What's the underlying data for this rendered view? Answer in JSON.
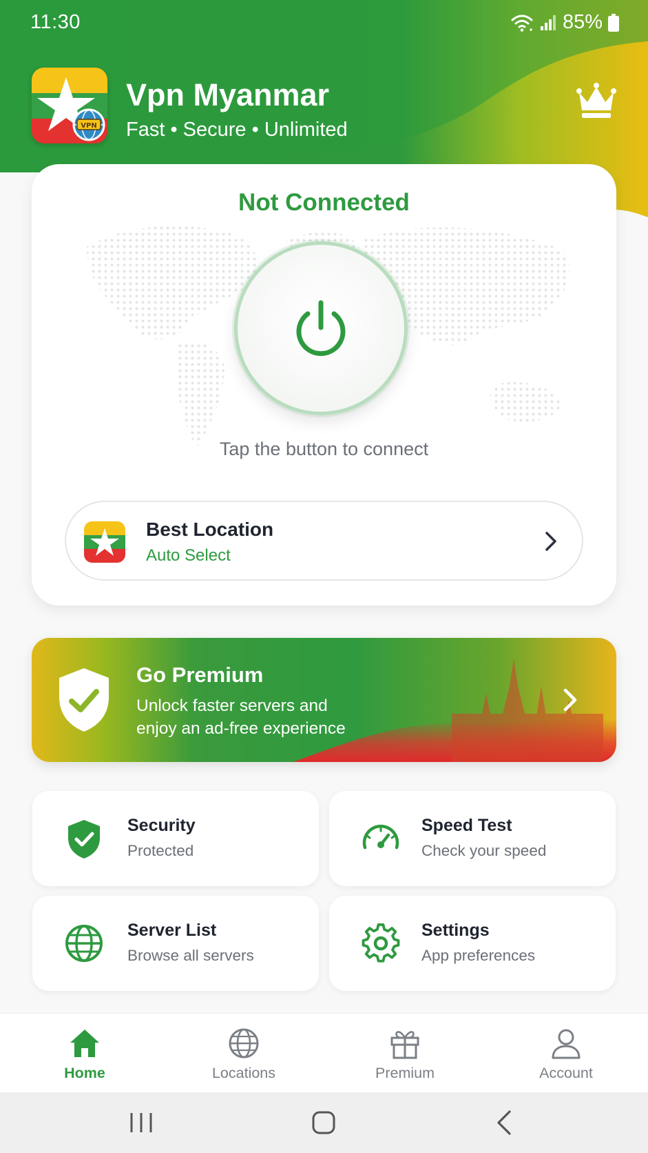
{
  "status_bar": {
    "time": "11:30",
    "battery": "85%"
  },
  "header": {
    "title": "Vpn Myanmar",
    "subtitle": "Fast • Secure • Unlimited",
    "logo_badge": "VPN"
  },
  "connection": {
    "status": "Not Connected",
    "hint": "Tap the button to connect"
  },
  "location": {
    "title": "Best Location",
    "subtitle": "Auto Select"
  },
  "premium": {
    "title": "Go Premium",
    "line1": "Unlock faster servers and",
    "line2": "enjoy an ad-free experience"
  },
  "features": [
    {
      "title": "Security",
      "subtitle": "Protected",
      "icon": "shield-check-icon"
    },
    {
      "title": "Speed Test",
      "subtitle": "Check your speed",
      "icon": "speedometer-icon"
    },
    {
      "title": "Server List",
      "subtitle": "Browse all servers",
      "icon": "globe-icon"
    },
    {
      "title": "Settings",
      "subtitle": "App preferences",
      "icon": "gear-icon"
    }
  ],
  "nav": [
    {
      "label": "Home",
      "icon": "home-icon",
      "active": true
    },
    {
      "label": "Locations",
      "icon": "globe-icon",
      "active": false
    },
    {
      "label": "Premium",
      "icon": "gift-icon",
      "active": false
    },
    {
      "label": "Account",
      "icon": "user-icon",
      "active": false
    }
  ],
  "colors": {
    "primary_green": "#2e9a3f",
    "flag_yellow": "#f6c318",
    "flag_red": "#e3322f",
    "text_dark": "#1f2430",
    "text_muted": "#6b6f77"
  }
}
